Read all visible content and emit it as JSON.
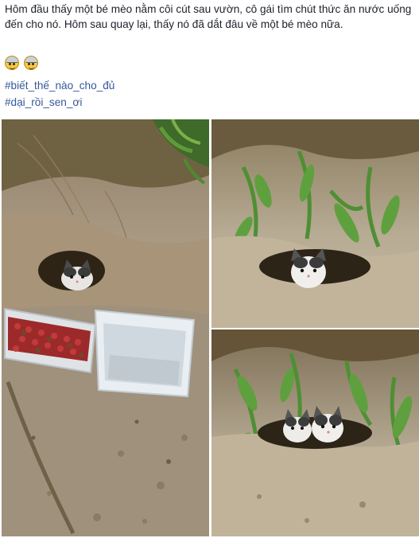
{
  "post": {
    "text": "Hôm đầu thấy một bé mèo nằm côi cút sau vườn, cô gái tìm chút thức ăn nước uống đến cho nó. Hôm sau quay lại, thấy nó đã dắt đâu về một bé mèo nữa.",
    "emojis": [
      "emoji-hardhat-icon",
      "emoji-hardhat-icon"
    ],
    "hashtags": [
      "#biết_thế_nào_cho_đủ",
      "#dại_rồi_sen_ơi"
    ]
  },
  "photos": {
    "main": "photo-kitten-with-food-and-water",
    "top_right": "photo-kitten-in-burrow",
    "bottom_right": "photo-two-kittens-in-burrow"
  }
}
